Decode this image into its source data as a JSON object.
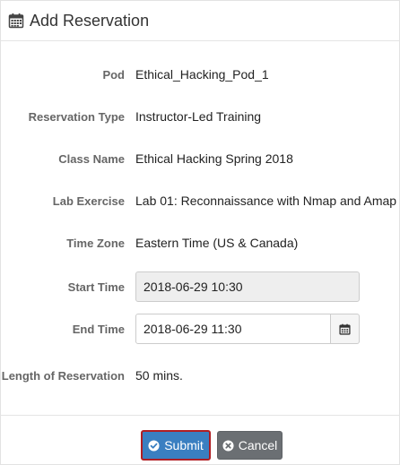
{
  "header": {
    "title": "Add Reservation",
    "icon": "calendar-icon"
  },
  "fields": {
    "pod": {
      "label": "Pod",
      "value": "Ethical_Hacking_Pod_1"
    },
    "reservation_type": {
      "label": "Reservation Type",
      "value": "Instructor-Led Training"
    },
    "class_name": {
      "label": "Class Name",
      "value": "Ethical Hacking Spring 2018"
    },
    "lab_exercise": {
      "label": "Lab Exercise",
      "value": "Lab 01: Reconnaissance with Nmap and Amap"
    },
    "time_zone": {
      "label": "Time Zone",
      "value": "Eastern Time (US & Canada)"
    },
    "start_time": {
      "label": "Start Time",
      "value": "2018-06-29 10:30"
    },
    "end_time": {
      "label": "End Time",
      "value": "2018-06-29 11:30"
    },
    "length": {
      "label": "Length of Reservation",
      "value": "50 mins."
    }
  },
  "buttons": {
    "submit": {
      "label": "Submit",
      "icon": "check-circle-icon"
    },
    "cancel": {
      "label": "Cancel",
      "icon": "times-circle-icon"
    }
  },
  "colors": {
    "submit": "#3a7fc1",
    "submit_focus_border": "#b01e23",
    "cancel": "#6b6f73",
    "readonly_bg": "#eeeeee",
    "label": "#666666"
  }
}
